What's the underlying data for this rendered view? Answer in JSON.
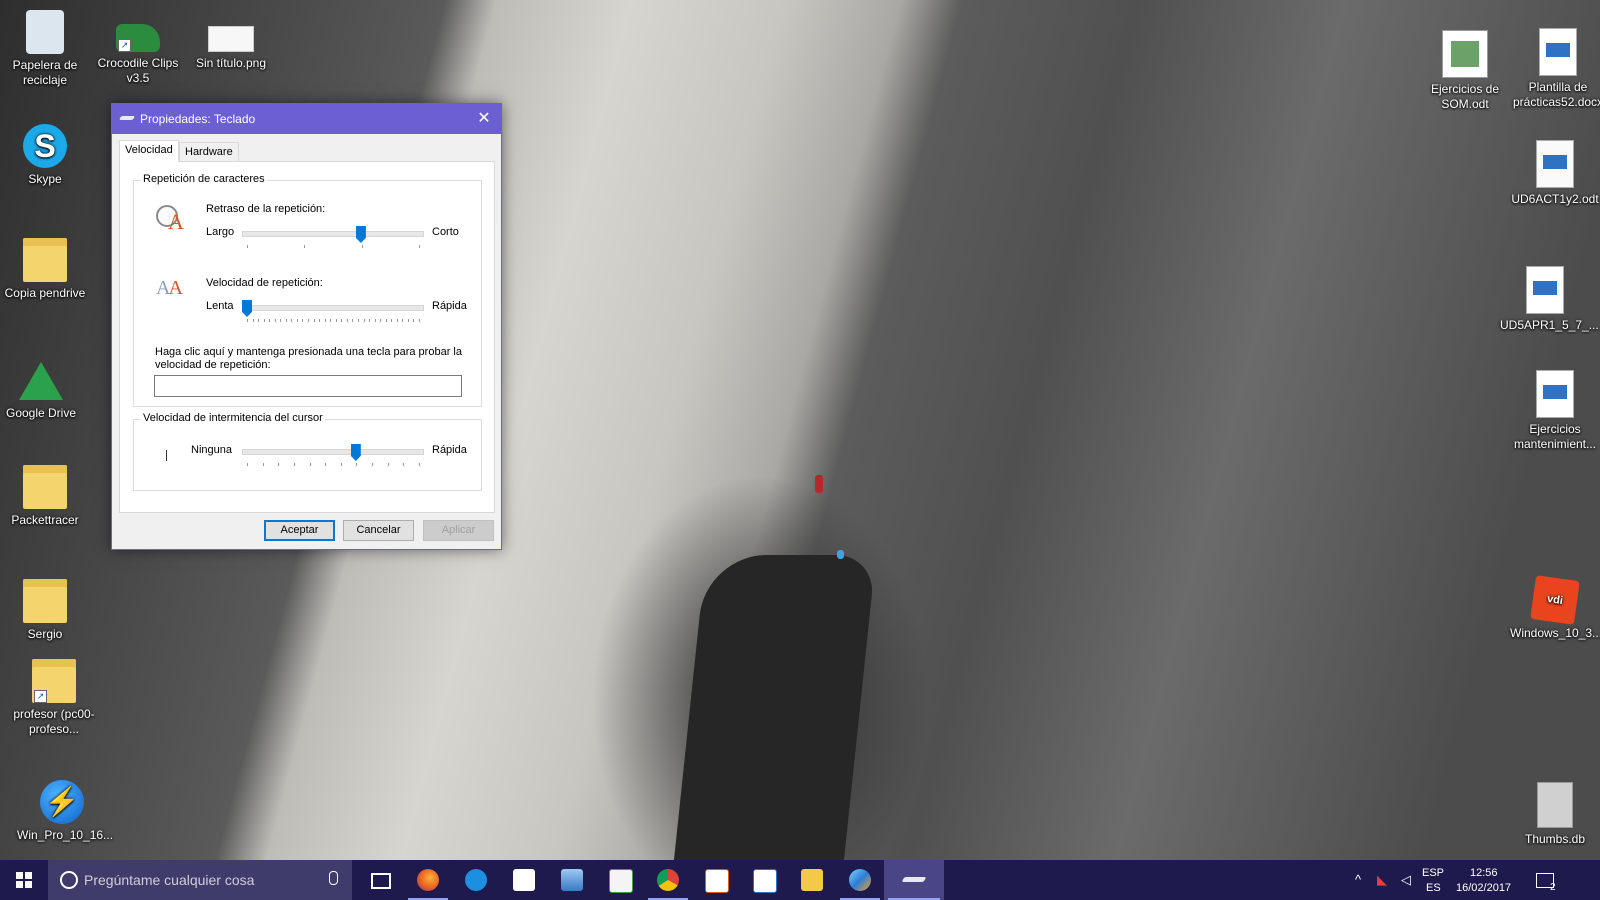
{
  "desktop": {
    "icons_left": [
      {
        "label": "Papelera de reciclaje",
        "icon": "recycle-bin-icon"
      },
      {
        "label": "Crocodile Clips v3.5",
        "icon": "crocodile-clips-icon"
      },
      {
        "label": "Sin título.png",
        "icon": "image-file-icon"
      },
      {
        "label": "Skype",
        "icon": "skype-icon"
      },
      {
        "label": "Copia pendrive",
        "icon": "folder-icon"
      },
      {
        "label": "Google Drive",
        "icon": "google-drive-icon"
      },
      {
        "label": "Packettracer",
        "icon": "folder-icon"
      },
      {
        "label": "Sergio",
        "icon": "folder-icon"
      },
      {
        "label": "profesor (pc00-profeso...",
        "icon": "network-folder-icon"
      },
      {
        "label": "Win_Pro_10_16...",
        "icon": "disk-image-icon"
      }
    ],
    "icons_right": [
      {
        "label": "Ejercicios de SOM.odt",
        "icon": "odt-document-icon"
      },
      {
        "label": "Plantilla de prácticas52.docx",
        "icon": "docx-document-icon"
      },
      {
        "label": "UD6ACT1y2.odt",
        "icon": "odt-document-icon"
      },
      {
        "label": "UD5APR1_5_7_...",
        "icon": "document-icon"
      },
      {
        "label": "Ejercicios mantenimient...",
        "icon": "document-icon"
      },
      {
        "label": "Windows_10_3...",
        "icon": "virtualbox-disk-icon"
      },
      {
        "label": "Thumbs.db",
        "icon": "system-file-icon"
      }
    ]
  },
  "dialog": {
    "title": "Propiedades: Teclado",
    "close_glyph": "✕",
    "tabs": [
      "Velocidad",
      "Hardware"
    ],
    "active_tab": "Velocidad",
    "repeat_group": {
      "label": "Repetición de caracteres",
      "delay_label": "Retraso de la repetición:",
      "delay_min": "Largo",
      "delay_max": "Corto",
      "delay_value": 0.67,
      "rate_label": "Velocidad de repetición:",
      "rate_min": "Lenta",
      "rate_max": "Rápida",
      "rate_value": 0.0,
      "test_label_line1": "Haga clic aquí y mantenga presionada una tecla para probar la",
      "test_label_line2": "velocidad de repetición:",
      "test_value": ""
    },
    "cursor_group": {
      "label": "Velocidad de intermitencia del cursor",
      "min": "Ninguna",
      "max": "Rápida",
      "value": 0.64
    },
    "buttons": {
      "ok": "Aceptar",
      "cancel": "Cancelar",
      "apply": "Aplicar"
    }
  },
  "taskbar": {
    "search_placeholder": "Pregúntame cualquier cosa",
    "apps": [
      "task-view-icon",
      "firefox-icon",
      "edge-icon",
      "store-icon",
      "network-computer-icon",
      "spreadsheet-icon",
      "chrome-icon",
      "impress-icon",
      "writer-icon",
      "file-explorer-icon",
      "control-panel-icon",
      "keyboard-properties-icon"
    ],
    "tray": {
      "lang_top": "ESP",
      "lang_bottom": "ES",
      "time": "12:56",
      "date": "16/02/2017",
      "notification_count": "2"
    }
  },
  "colors": {
    "taskbar": "#1f1a4d",
    "title_bar": "#6c5fd4",
    "slider_thumb": "#0078d7"
  }
}
